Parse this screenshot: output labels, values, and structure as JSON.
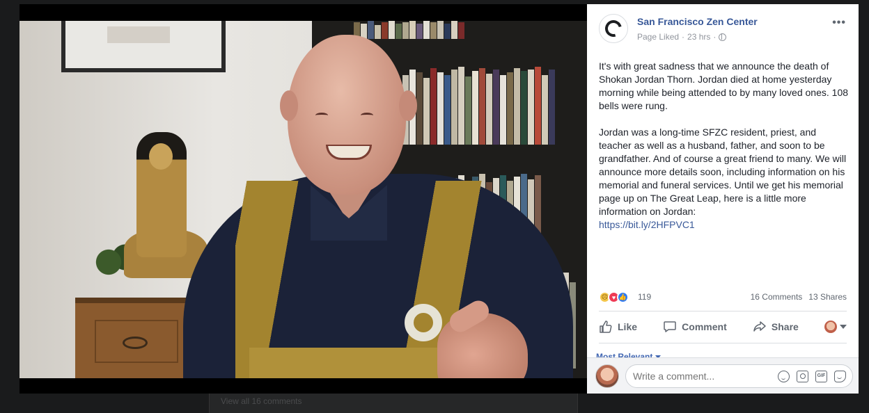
{
  "background": {
    "underlay_text": "View all 16 comments"
  },
  "post": {
    "page_name": "San Francisco Zen Center",
    "status": "Page Liked",
    "time": "23 hrs",
    "paragraph_1": "It's with great sadness that we announce the death of Shokan Jordan Thorn. Jordan died at home yesterday morning while being attended to by many loved ones. 108 bells were rung.",
    "paragraph_2": "Jordan was a long-time SFZC resident, priest, and teacher as well as a husband, father, and soon to be grandfather. And of course a great friend to many. We will announce more details soon, including information on his memorial and funeral services. Until we get his memorial page up on The Great Leap, here is a little more information on Jordan:",
    "link": "https://bit.ly/2HFPVC1",
    "reaction_count": "119",
    "comments_count": "16 Comments",
    "shares_count": "13 Shares"
  },
  "actions": {
    "like": "Like",
    "comment": "Comment",
    "share": "Share"
  },
  "comments": {
    "sort_label": "Most Relevant",
    "input_placeholder": "Write a comment...",
    "gif_label": "GIF"
  },
  "icons": {
    "reactions": [
      "sad-reaction-icon",
      "love-reaction-icon",
      "like-reaction-icon"
    ],
    "more": "more-options-icon",
    "globe": "globe-icon"
  },
  "colors": {
    "link": "#385898",
    "text": "#1d2129",
    "muted": "#606770",
    "like_blue": "#2e7bf6",
    "love_red": "#ef3b55"
  }
}
